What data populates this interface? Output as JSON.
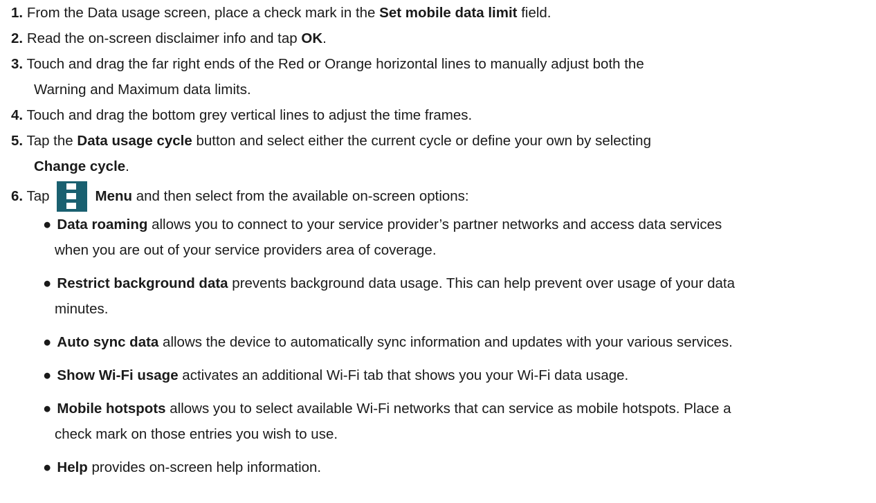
{
  "steps": [
    {
      "num": "1.",
      "pre": "From the Data usage screen, place a check mark in the ",
      "bold": "Set mobile data limit",
      "post": " field."
    },
    {
      "num": "2.",
      "pre": "Read the on-screen disclaimer info and tap ",
      "bold": "OK",
      "post": "."
    },
    {
      "num": "3.",
      "line1": "Touch and drag the far right ends of the Red or Orange horizontal lines to manually adjust both the",
      "line2": "Warning and Maximum data limits."
    },
    {
      "num": "4.",
      "text": "Touch and drag the bottom grey vertical lines to adjust the time frames."
    },
    {
      "num": "5.",
      "pre": "Tap the ",
      "bold": "Data usage cycle",
      "post": " button and select either the current cycle or define your own by selecting",
      "bold2": "Change cycle",
      "post2": "."
    },
    {
      "num": "6.",
      "pre": "Tap",
      "bold": "Menu",
      "post": " and then select from the available on-screen options:"
    }
  ],
  "options": [
    {
      "bold": "Data roaming",
      "line1": " allows you to connect to your service provider’s partner networks and access data services",
      "line2": "when you are out of your service providers area of coverage."
    },
    {
      "bold": "Restrict background data",
      "line1": " prevents background data usage. This can help prevent over usage of your data",
      "line2": "minutes."
    },
    {
      "bold": "Auto sync data",
      "line1": " allows the device to automatically sync information and updates with your various services."
    },
    {
      "bold": "Show Wi-Fi usage",
      "line1": " activates an additional Wi-Fi tab that shows you your Wi-Fi data usage."
    },
    {
      "bold": "Mobile hotspots",
      "line1": " allows you to select available Wi-Fi networks that can service as mobile hotspots. Place a",
      "line2": "check mark on those entries you wish to use."
    },
    {
      "bold": "Help",
      "line1": " provides on-screen help information."
    }
  ],
  "bullet_char": "●",
  "icons": {
    "menu": "menu-icon",
    "menu_color": "#1a6070"
  }
}
